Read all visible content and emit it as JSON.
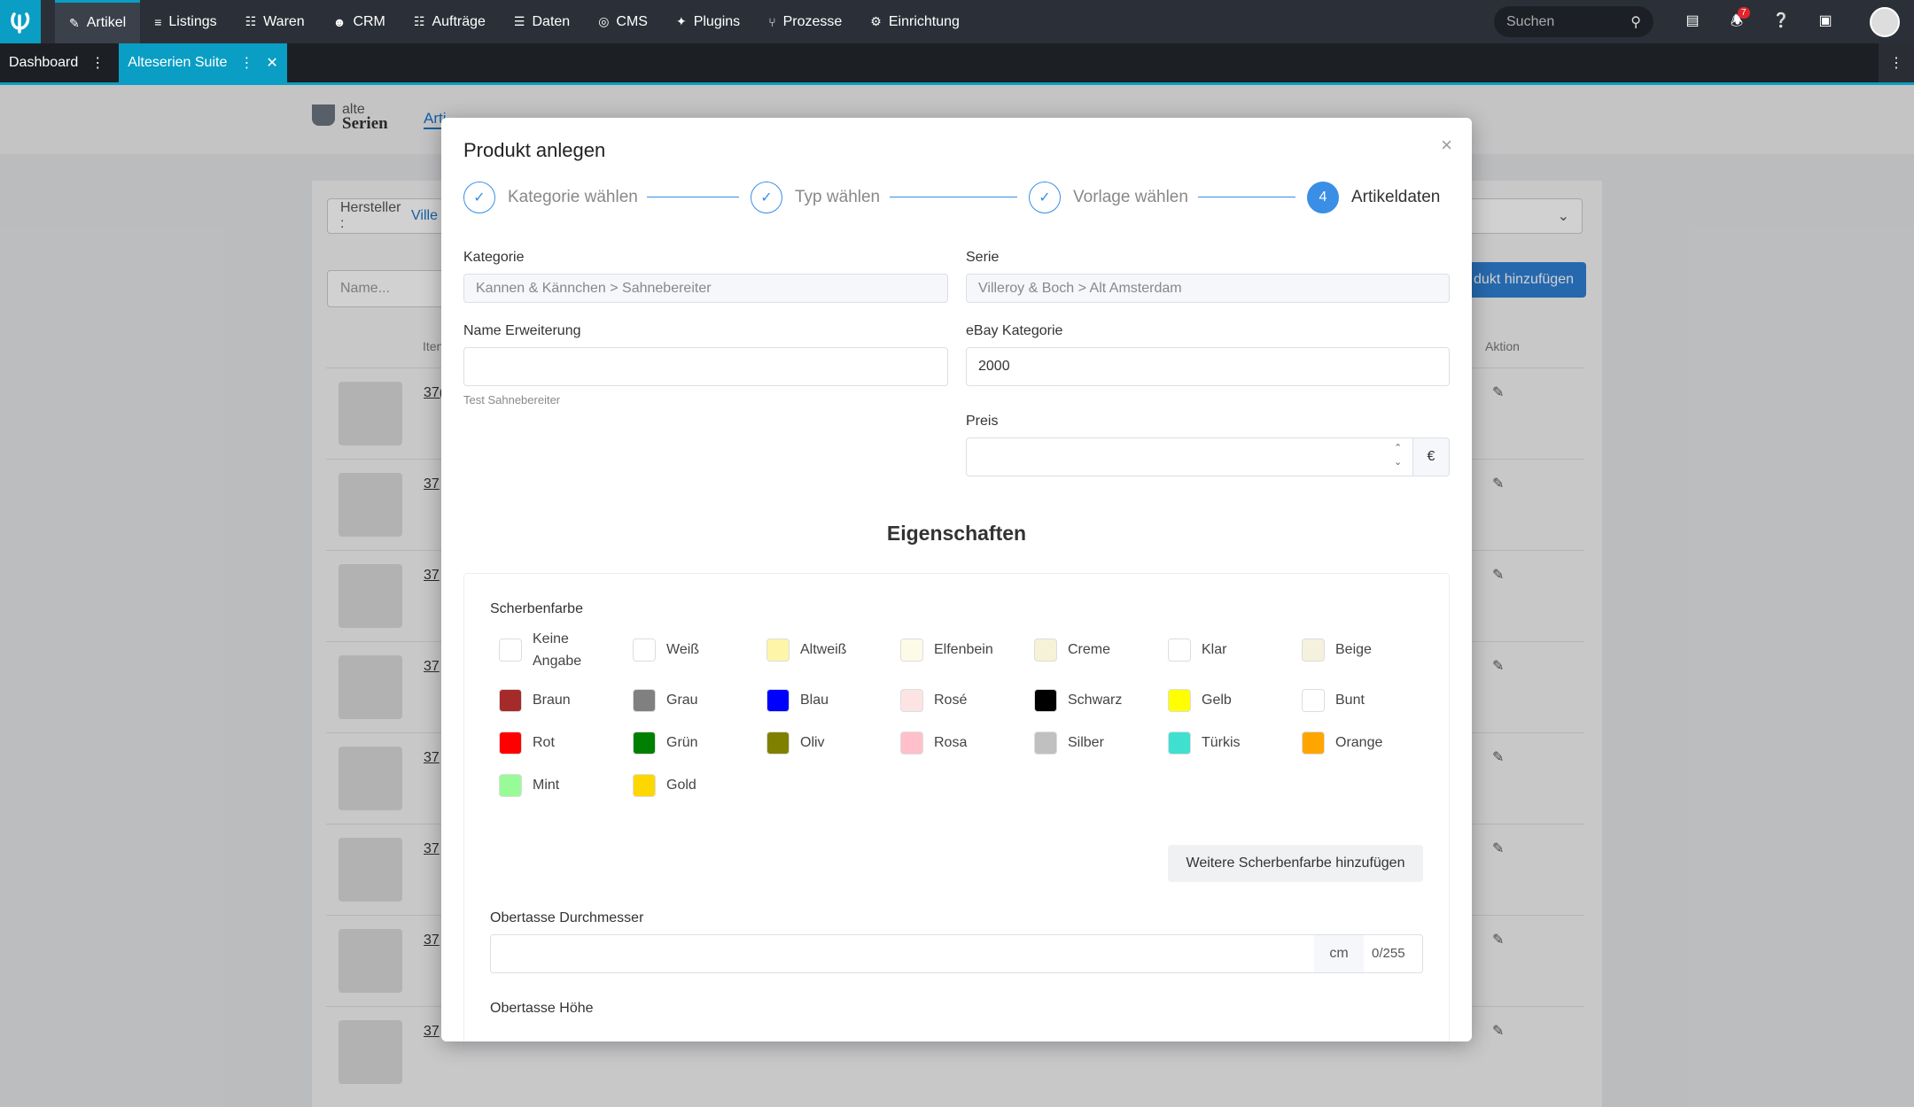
{
  "nav": {
    "items": [
      {
        "label": "Artikel",
        "icon": "tag-icon",
        "active": true
      },
      {
        "label": "Listings",
        "icon": "list-icon"
      },
      {
        "label": "Waren",
        "icon": "boxes-icon"
      },
      {
        "label": "CRM",
        "icon": "users-icon"
      },
      {
        "label": "Aufträge",
        "icon": "cart-icon"
      },
      {
        "label": "Daten",
        "icon": "database-icon"
      },
      {
        "label": "CMS",
        "icon": "globe-icon"
      },
      {
        "label": "Plugins",
        "icon": "puzzle-icon"
      },
      {
        "label": "Prozesse",
        "icon": "process-icon"
      },
      {
        "label": "Einrichtung",
        "icon": "gear-icon"
      }
    ],
    "search_placeholder": "Suchen",
    "notification_count": "7"
  },
  "tabs": [
    {
      "label": "Dashboard"
    },
    {
      "label": "Alteserien Suite",
      "active": true
    }
  ],
  "background": {
    "brand_line1": "alte",
    "brand_line2": "Serien",
    "bg_tab": "Arti",
    "hersteller_label": "Hersteller :",
    "hersteller_value": "Ville",
    "name_placeholder": "Name...",
    "add_button": "dukt hinzufügen",
    "col_item": "Iten",
    "col_action": "Aktion",
    "row_ids": [
      "37(",
      "37",
      "37",
      "37",
      "37",
      "37",
      "37",
      "37"
    ]
  },
  "modal": {
    "title": "Produkt anlegen",
    "steps": [
      {
        "label": "Kategorie wählen",
        "state": "done"
      },
      {
        "label": "Typ wählen",
        "state": "done"
      },
      {
        "label": "Vorlage wählen",
        "state": "done"
      },
      {
        "label": "Artikeldaten",
        "number": "4",
        "state": "current"
      }
    ],
    "kategorie_label": "Kategorie",
    "kategorie_value": "Kannen & Kännchen > Sahnebereiter",
    "serie_label": "Serie",
    "serie_value": "Villeroy & Boch > Alt Amsterdam",
    "name_ext_label": "Name Erweiterung",
    "name_ext_value": "",
    "name_ext_hint": "Test Sahnebereiter",
    "ebay_label": "eBay Kategorie",
    "ebay_value": "2000",
    "preis_label": "Preis",
    "preis_value": "",
    "preis_unit": "€",
    "eigenschaften_title": "Eigenschaften",
    "scherbenfarbe_label": "Scherbenfarbe",
    "colors": [
      {
        "name": "Keine",
        "name2": "Angabe",
        "color": "#ffffff"
      },
      {
        "name": "Weiß",
        "color": "#ffffff"
      },
      {
        "name": "Altweiß",
        "color": "#fdf6a8"
      },
      {
        "name": "Elfenbein",
        "color": "#fdfbe8"
      },
      {
        "name": "Creme",
        "color": "#f6f2d8"
      },
      {
        "name": "Klar",
        "color": "#ffffff"
      },
      {
        "name": "Beige",
        "color": "#f4f2dc"
      },
      {
        "name": "Braun",
        "color": "#a52a2a"
      },
      {
        "name": "Grau",
        "color": "#808080"
      },
      {
        "name": "Blau",
        "color": "#0000ff"
      },
      {
        "name": "Rosé",
        "color": "#fde4e4"
      },
      {
        "name": "Schwarz",
        "color": "#000000"
      },
      {
        "name": "Gelb",
        "color": "#ffff00"
      },
      {
        "name": "Bunt",
        "color": "#ffffff"
      },
      {
        "name": "Rot",
        "color": "#ff0000"
      },
      {
        "name": "Grün",
        "color": "#008000"
      },
      {
        "name": "Oliv",
        "color": "#808000"
      },
      {
        "name": "Rosa",
        "color": "#ffc0cb"
      },
      {
        "name": "Silber",
        "color": "#c0c0c0"
      },
      {
        "name": "Türkis",
        "color": "#40e0d0"
      },
      {
        "name": "Orange",
        "color": "#ffa500"
      },
      {
        "name": "Mint",
        "color": "#98fb98"
      },
      {
        "name": "Gold",
        "color": "#ffd700"
      }
    ],
    "add_color_button": "Weitere Scherbenfarbe hinzufügen",
    "durchmesser_label": "Obertasse Durchmesser",
    "durchmesser_unit": "cm",
    "durchmesser_count": "0/255",
    "hoehe_label": "Obertasse Höhe"
  }
}
